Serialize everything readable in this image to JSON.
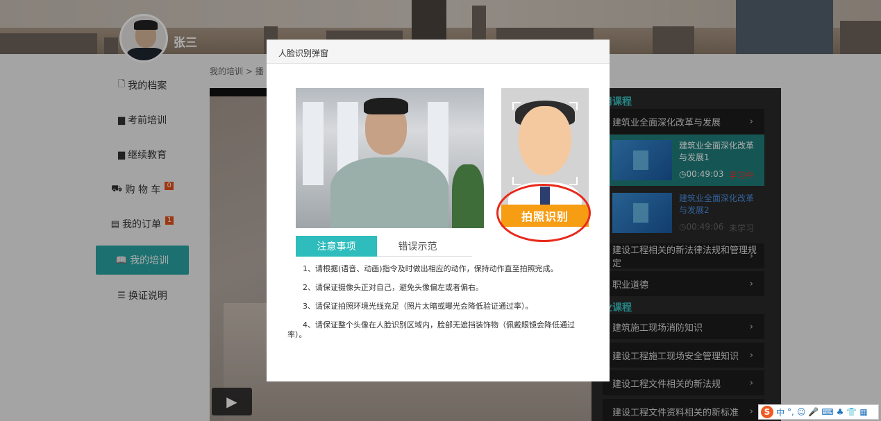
{
  "user": {
    "name": "张三"
  },
  "nav": {
    "items": [
      {
        "label": "我的档案",
        "icon": "document-icon"
      },
      {
        "label": "考前培训",
        "icon": "presentation-icon"
      },
      {
        "label": "继续教育",
        "icon": "presentation-icon"
      },
      {
        "label": "购 物 车",
        "icon": "cart-icon",
        "badge": "0"
      },
      {
        "label": "我的订单",
        "icon": "order-icon",
        "badge": "1"
      },
      {
        "label": "我的培训",
        "icon": "book-icon",
        "active": true
      },
      {
        "label": "换证说明",
        "icon": "list-icon"
      }
    ]
  },
  "breadcrumb": {
    "root": "我的培训",
    "sep": ">",
    "current": "播"
  },
  "panel": {
    "section1": "用课程",
    "section2": "业课程",
    "courses_top": [
      {
        "label": "建筑业全面深化改革与发展"
      }
    ],
    "lessons": [
      {
        "title": "建筑业全面深化改革与发展1",
        "duration": "00:49:03",
        "status": "学习中"
      },
      {
        "title": "建筑业全面深化改革与发展2",
        "duration": "00:49:06",
        "status": "未学习"
      }
    ],
    "courses_mid": [
      {
        "label": "建设工程相关的新法律法规和管理规定"
      },
      {
        "label": "职业道德"
      }
    ],
    "courses_bottom": [
      {
        "label": "建筑施工现场消防知识"
      },
      {
        "label": "建设工程施工现场安全管理知识"
      },
      {
        "label": "建设工程文件相关的新法规"
      },
      {
        "label": "建设工程文件资料相关的新标准"
      }
    ]
  },
  "modal": {
    "title": "人脸识别弹窗",
    "capture_button": "拍照识别",
    "tabs": [
      {
        "label": "注意事项",
        "active": true
      },
      {
        "label": "错误示范"
      }
    ],
    "notes": [
      "1、请根据(语音、动画)指令及时做出相应的动作，保持动作直至拍照完成。",
      "2、请保证摄像头正对自己，避免头像偏左或者偏右。",
      "3、请保证拍照环境光线充足（照片太暗或曝光会降低验证通过率）。",
      "4、请保证整个头像在人脸识别区域内，脸部无遮挡装饰物（佩戴眼镜会降低通过率）。"
    ]
  },
  "ime": {
    "label": "中",
    "extra": "°,"
  },
  "colors": {
    "accent": "#2aa6a5",
    "capture": "#f69d14",
    "alert": "#e8291b"
  }
}
